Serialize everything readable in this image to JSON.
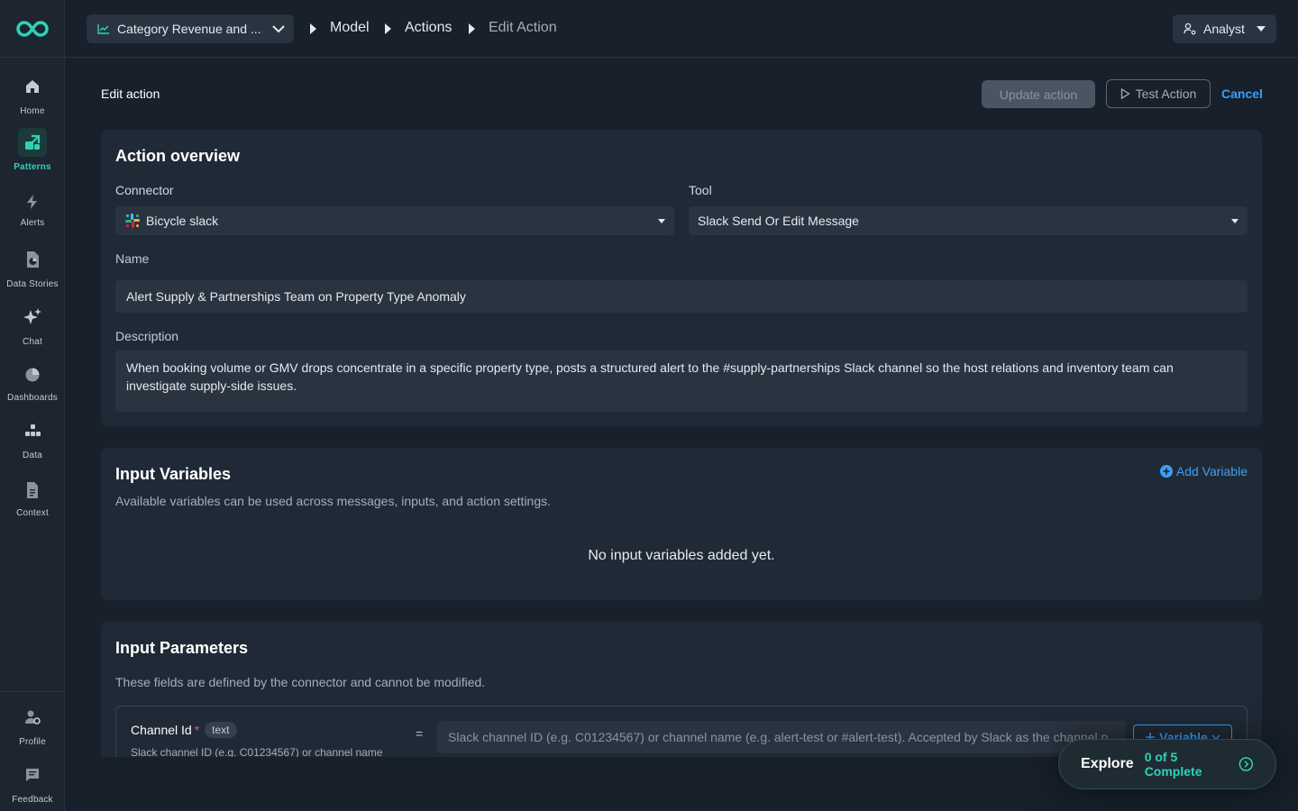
{
  "sidebar": {
    "items": [
      {
        "label": "Home",
        "icon": "home-icon"
      },
      {
        "label": "Patterns",
        "icon": "patterns-icon",
        "active": true
      },
      {
        "label": "Alerts",
        "icon": "bolt-icon"
      },
      {
        "label": "Data Stories",
        "icon": "data-stories-icon"
      },
      {
        "label": "Chat",
        "icon": "sparkle-icon"
      },
      {
        "label": "Dashboards",
        "icon": "pie-icon"
      },
      {
        "label": "Data",
        "icon": "data-icon"
      },
      {
        "label": "Context",
        "icon": "document-icon"
      }
    ],
    "bottom": [
      {
        "label": "Profile",
        "icon": "profile-gear-icon"
      },
      {
        "label": "Feedback",
        "icon": "feedback-icon"
      }
    ]
  },
  "topbar": {
    "context_selector": "Category Revenue and ...",
    "breadcrumbs": [
      "Model",
      "Actions",
      "Edit Action"
    ],
    "role": "Analyst"
  },
  "header": {
    "title": "Edit action",
    "update_button": "Update action",
    "test_button": "Test Action",
    "cancel_button": "Cancel"
  },
  "overview": {
    "title": "Action overview",
    "connector_label": "Connector",
    "connector_value": "Bicycle slack",
    "tool_label": "Tool",
    "tool_value": "Slack Send Or Edit Message",
    "name_label": "Name",
    "name_value": "Alert Supply & Partnerships Team on Property Type Anomaly",
    "description_label": "Description",
    "description_value": "When booking volume or GMV drops concentrate in a specific property type, posts a structured alert to the #supply-partnerships Slack channel so the host relations and inventory team can investigate supply-side issues."
  },
  "input_variables": {
    "title": "Input Variables",
    "add_label": "Add Variable",
    "subtitle": "Available variables can be used across messages, inputs, and action settings.",
    "empty_text": "No input variables added yet."
  },
  "input_parameters": {
    "title": "Input Parameters",
    "subtitle": "These fields are defined by the connector and cannot be modified.",
    "params": [
      {
        "name": "Channel Id",
        "required": "*",
        "type": "text",
        "description": "Slack channel ID (e.g. C01234567) or channel name",
        "operator": "=",
        "placeholder": "Slack channel ID (e.g. C01234567) or channel name (e.g. alert-test or #alert-test). Accepted by Slack as the channel p",
        "variable_button": "Variable"
      }
    ]
  },
  "explore": {
    "label": "Explore",
    "progress": "0 of 5 Complete"
  },
  "colors": {
    "accent_teal": "#2ed3b7",
    "link_blue": "#3b9ff6",
    "background": "#17202b",
    "card": "#202a36"
  }
}
